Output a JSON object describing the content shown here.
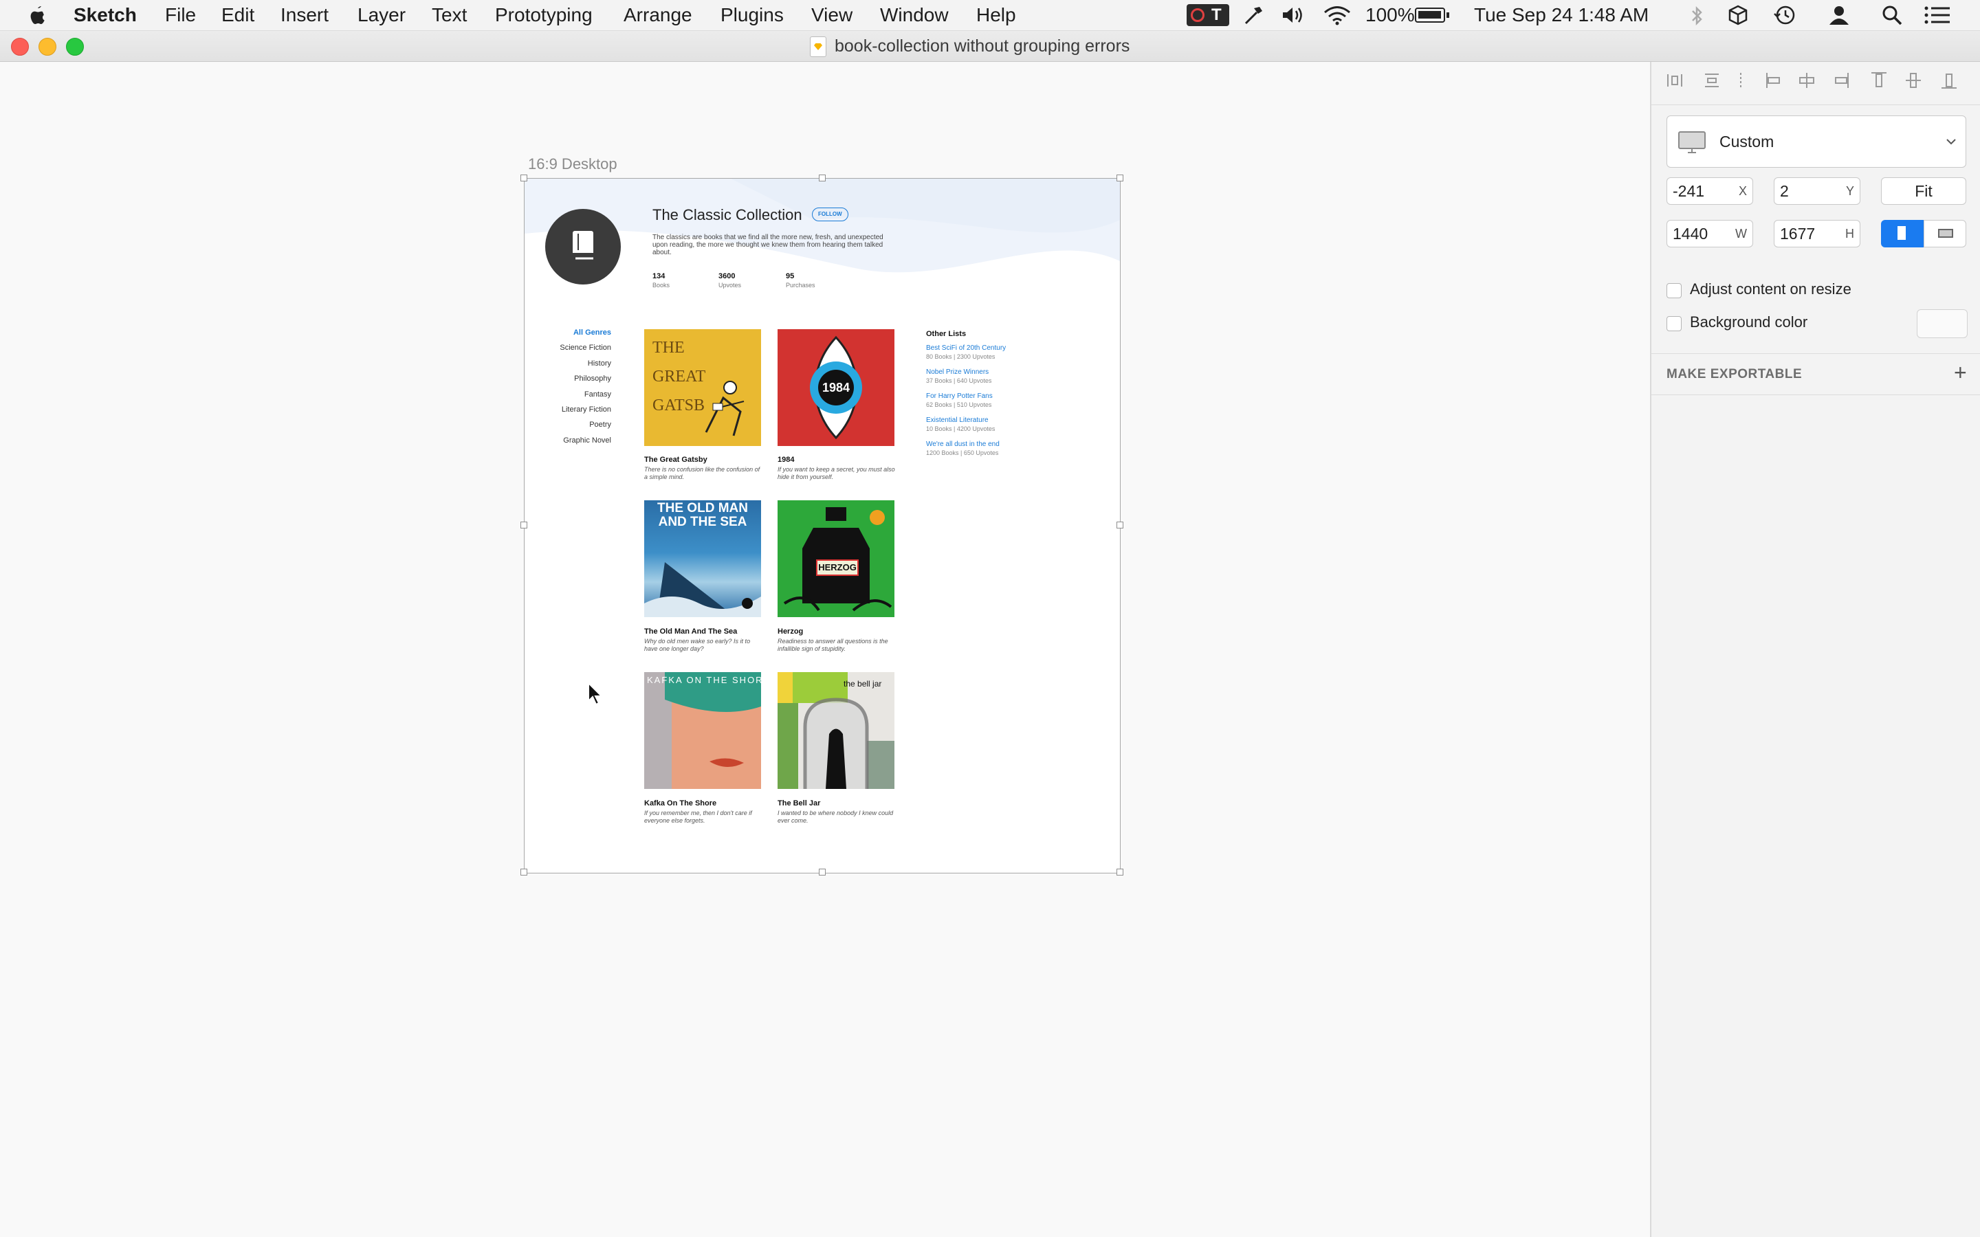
{
  "menubar": {
    "app_name": "Sketch",
    "items": [
      "File",
      "Edit",
      "Insert",
      "Layer",
      "Text",
      "Prototyping",
      "Arrange",
      "Plugins",
      "View",
      "Window",
      "Help"
    ],
    "battery": "100%",
    "clock": "Tue Sep 24  1:48 AM"
  },
  "window": {
    "title": "book-collection without grouping errors"
  },
  "artboard": {
    "label": "16:9 Desktop",
    "collection": {
      "title": "The Classic Collection",
      "follow_label": "FOLLOW",
      "description": "The classics are books that we find all the more new, fresh, and unexpected upon reading, the more we thought we knew them from hearing them talked about.",
      "stats": [
        {
          "value": "134",
          "label": "Books"
        },
        {
          "value": "3600",
          "label": "Upvotes"
        },
        {
          "value": "95",
          "label": "Purchases"
        }
      ]
    },
    "genres": [
      "All Genres",
      "Science Fiction",
      "History",
      "Philosophy",
      "Fantasy",
      "Literary Fiction",
      "Poetry",
      "Graphic Novel"
    ],
    "books": [
      {
        "title": "The Great Gatsby",
        "quote": "There is no confusion like the confusion of a simple mind.",
        "cover_text": "THE GREAT GATSB"
      },
      {
        "title": "1984",
        "quote": "If you want to keep a secret, you must also hide it from yourself.",
        "cover_text": "1984"
      },
      {
        "title": "The Old Man And The Sea",
        "quote": "Why do old men wake so early? Is it to have one longer day?",
        "cover_text": "THE OLD MAN AND THE SEA"
      },
      {
        "title": "Herzog",
        "quote": "Readiness to answer all questions is the infallible sign of stupidity.",
        "cover_text": "HERZOG"
      },
      {
        "title": "Kafka On The Shore",
        "quote": "If you remember me, then I don't care if everyone else forgets.",
        "cover_text": "KAFKA ON THE SHORE"
      },
      {
        "title": "The Bell Jar",
        "quote": "I wanted to be where nobody I knew could ever come.",
        "cover_text": "the bell jar"
      }
    ],
    "other_lists": {
      "heading": "Other Lists",
      "items": [
        {
          "name": "Best SciFi of 20th Century",
          "meta": "80 Books  |  2300 Upvotes"
        },
        {
          "name": "Nobel Prize Winners",
          "meta": "37 Books  |  640 Upvotes"
        },
        {
          "name": "For Harry Potter Fans",
          "meta": "62 Books  |  510 Upvotes"
        },
        {
          "name": "Existential Literature",
          "meta": "10 Books  |  4200 Upvotes"
        },
        {
          "name": "We're all dust in the end",
          "meta": "1200 Books  |  650 Upvotes"
        }
      ]
    }
  },
  "inspector": {
    "preset": "Custom",
    "x_value": "-241",
    "x_label": "X",
    "y_value": "2",
    "y_label": "Y",
    "fit_label": "Fit",
    "w_value": "1440",
    "w_label": "W",
    "h_value": "1677",
    "h_label": "H",
    "adjust_label": "Adjust content on resize",
    "bg_label": "Background color",
    "export_label": "MAKE EXPORTABLE",
    "export_plus": "+"
  },
  "colors": {
    "accent": "#1a7bd6",
    "gatsby": "#e9b931",
    "nineteen": "#d23330",
    "oldman": "#2a6ea7",
    "herzog": "#2da83a"
  }
}
